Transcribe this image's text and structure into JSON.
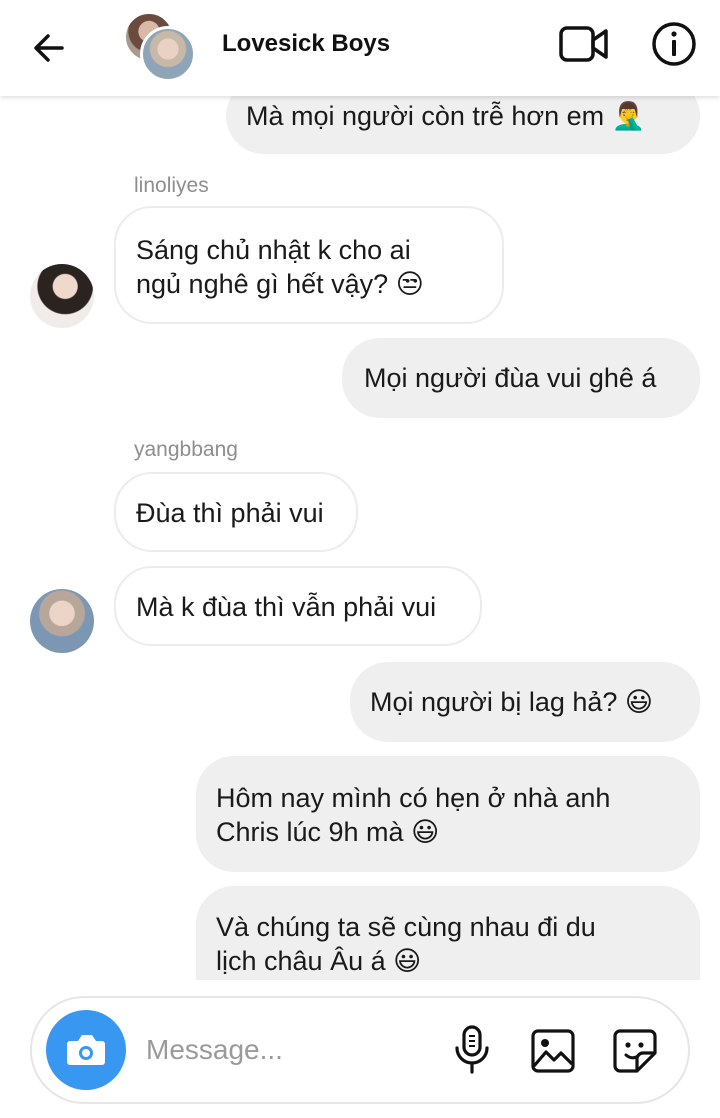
{
  "header": {
    "title": "Lovesick Boys",
    "icons": [
      "back-arrow-icon",
      "group-avatar",
      "video-call-icon",
      "info-icon"
    ]
  },
  "messages": [
    {
      "type": "outgoing",
      "text": "Mà mọi người còn trễ hơn em 🤦‍♂️"
    },
    {
      "type": "sender",
      "name": "linoliyes"
    },
    {
      "type": "incoming",
      "line1": "Sáng chủ nhật k cho ai",
      "line2": "ngủ nghê gì hết vậy? 😒"
    },
    {
      "type": "outgoing",
      "text": "Mọi người đùa vui ghê á"
    },
    {
      "type": "sender",
      "name": "yangbbang"
    },
    {
      "type": "incoming",
      "text": "Đùa thì phải vui"
    },
    {
      "type": "incoming",
      "text": "Mà k đùa thì vẫn phải vui"
    },
    {
      "type": "outgoing",
      "text": "Mọi người bị lag hả? 😃"
    },
    {
      "type": "outgoing",
      "line1": "Hôm nay mình có hẹn ở nhà anh",
      "line2": "Chris lúc 9h mà 😃"
    },
    {
      "type": "outgoing",
      "line1": "Và chúng ta sẽ cùng nhau đi du",
      "line2": "lịch châu Âu á 😃"
    }
  ],
  "composer": {
    "placeholder": "Message...",
    "value": ""
  },
  "colors": {
    "accent": "#3897f0",
    "outgoing_bubble": "#efefef",
    "incoming_border": "#ececec",
    "sender_text": "#8e8e8e"
  }
}
